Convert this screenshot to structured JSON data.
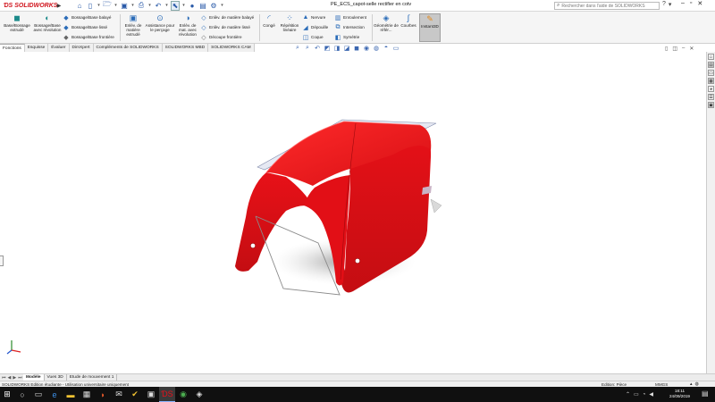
{
  "app": {
    "logo": "SOLIDWORKS",
    "document_title": "PE_ECS_capot-selle rectifier en cotv"
  },
  "search": {
    "placeholder": "Rechercher dans l'aide de SOLIDWORKS"
  },
  "ribbon": {
    "extrude_boss": "Base/Bossage extrudé",
    "revolve_boss": "Bossage/Base avec révolution",
    "sweep_boss": "Bossage/Base balayé",
    "loft_boss": "Bossage/Base lissé",
    "boundary_boss": "Bossage/Base frontière",
    "extrude_cut": "Enlèv. de matière extrudé",
    "hole_wizard": "Assistance pour le perçage",
    "revolve_cut": "Enlèv. de mat. avec révolution",
    "sweep_cut": "Enlèv. de matière balayé",
    "loft_cut": "Enlèv. de matière lissé",
    "boundary_cut": "Découpe frontière",
    "fillet": "Congé",
    "linear_pattern": "Répétition linéaire",
    "rib": "Nervure",
    "draft": "Dépouille",
    "shell": "Coque",
    "wrap": "Enroulement",
    "intersect": "Intersection",
    "mirror": "Symétrie",
    "ref_geometry": "Géométrie de référ...",
    "curves": "Courbes",
    "instant3d": "Instant3D"
  },
  "tabs": [
    "Fonctions",
    "Esquisse",
    "Évaluer",
    "DimXpert",
    "Compléments de SOLIDWORKS",
    "SOLIDWORKS MBD",
    "SOLIDWORKS CAM"
  ],
  "bottom_tabs": [
    "Modèle",
    "Vues 3D",
    "Etude de mouvement 1"
  ],
  "status": {
    "left": "SOLIDWORKS Edition étudiante - Utilisation universitaire uniquement",
    "edit": "Edition: Pièce",
    "units": "MMGS"
  },
  "taskbar": {
    "time": "18:11",
    "date": "24/09/2019"
  },
  "colors": {
    "part_red": "#e8101a",
    "brand_red": "#d0121b"
  }
}
